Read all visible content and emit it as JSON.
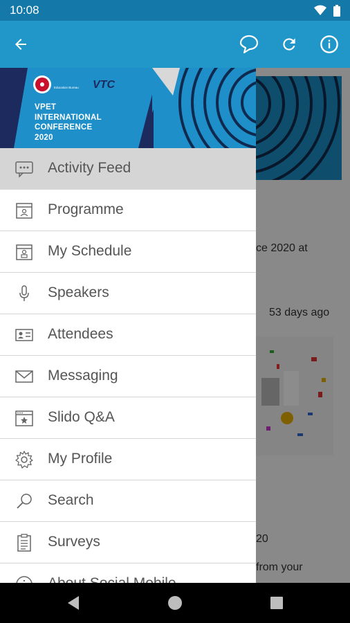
{
  "status_bar": {
    "time": "10:08"
  },
  "app_bar": {
    "back_icon": "arrow-back-icon",
    "actions": [
      "chat-icon",
      "refresh-icon",
      "info-icon"
    ]
  },
  "drawer": {
    "header": {
      "org_name": "Education Bureau",
      "logo_text": "VTC",
      "title_lines": [
        "VPET",
        "INTERNATIONAL",
        "CONFERENCE",
        "2020"
      ]
    },
    "items": [
      {
        "label": "Activity Feed",
        "icon": "chat-bubble-icon",
        "active": true
      },
      {
        "label": "Programme",
        "icon": "calendar-icon"
      },
      {
        "label": "My Schedule",
        "icon": "calendar-person-icon"
      },
      {
        "label": "Speakers",
        "icon": "microphone-icon"
      },
      {
        "label": "Attendees",
        "icon": "id-card-icon"
      },
      {
        "label": "Messaging",
        "icon": "envelope-icon"
      },
      {
        "label": "Slido Q&A",
        "icon": "window-star-icon"
      },
      {
        "label": "My Profile",
        "icon": "gear-icon"
      },
      {
        "label": "Search",
        "icon": "search-icon"
      },
      {
        "label": "Surveys",
        "icon": "clipboard-icon"
      },
      {
        "label": "About Social Mobile",
        "icon": "info-circle-icon"
      }
    ]
  },
  "background": {
    "snippet_1": "ce 2020 at",
    "post_time": "53 days ago",
    "snippet_2": "20",
    "snippet_3": "from your"
  },
  "colors": {
    "primary": "#2196c8",
    "status_bar": "#1478a8",
    "header_navy": "#1c2a5e"
  }
}
